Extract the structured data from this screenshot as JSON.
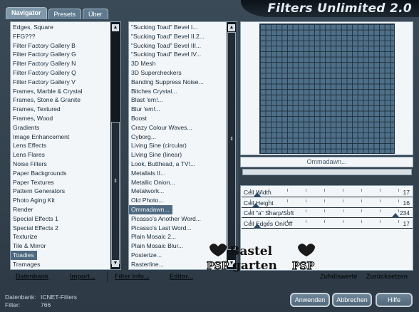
{
  "app_title": "Filters Unlimited 2.0",
  "tabs": [
    "Navigator",
    "Presets",
    "Über"
  ],
  "categories": [
    "Edges, Square",
    "FFG???",
    "Filter Factory Gallery B",
    "Filter Factory Gallery G",
    "Filter Factory Gallery N",
    "Filter Factory Gallery Q",
    "Filter Factory Gallery V",
    "Frames, Marble & Crystal",
    "Frames, Stone & Granite",
    "Frames, Textured",
    "Frames, Wood",
    "Gradients",
    "Image Enhancement",
    "Lens Effects",
    "Lens Flares",
    "Noise Filters",
    "Paper Backgrounds",
    "Paper Textures",
    "Pattern Generators",
    "Photo Aging Kit",
    "Render",
    "Special Effects 1",
    "Special Effects 2",
    "Texturize",
    "Tile & Mirror",
    "Toadies",
    "Tramages"
  ],
  "selected_category": "Toadies",
  "filters": [
    "\"Sucking Toad\"  Bevel I...",
    "\"Sucking Toad\"  Bevel II.2...",
    "\"Sucking Toad\"  Bevel III...",
    "\"Sucking Toad\"  Bevel IV...",
    "3D Mesh",
    "3D Supercheckers",
    "Banding Suppress Noise...",
    "Bitches Crystal...",
    "Blast 'em!...",
    "Blur 'em!...",
    "Boost",
    "Crazy Colour Waves...",
    "Cyborg...",
    "Living Sine (circular)",
    "Living Sine (linear)",
    "Look, Butthead, a TV!...",
    "Metallals II...",
    "Metallic Onion...",
    "Metalwork...",
    "Old Photo...",
    "Ommadawn...",
    "Picasso's Another Word...",
    "Picasso's Last Word...",
    "Plain Mosaic 2...",
    "Plain Mosaic Blur...",
    "Posterize...",
    "Rasterline..."
  ],
  "selected_filter": "Ommadawn...",
  "preview_filter_name": "Ommadawn...",
  "sliders": [
    {
      "label": "Cell Width",
      "value": "17",
      "level": 0.07
    },
    {
      "label": "Cell Height",
      "value": "16",
      "level": 0.06
    },
    {
      "label": "Cell \"a\" Sharp/Soft",
      "value": "234",
      "level": 0.92
    },
    {
      "label": "Cell Edges On/Off",
      "value": "17",
      "level": 0.07
    }
  ],
  "watermark_text": "Bastel PSP garten PSP",
  "actions": {
    "database": "Datenbank",
    "import": "Import...",
    "filter_info": "Filter Info...",
    "editor": "Editor...",
    "random": "Zufallswerte",
    "reset": "Zurücksetzen"
  },
  "info": {
    "db_label": "Datenbank:",
    "db_value": "ICNET-Filters",
    "filter_label": "Filter:",
    "filter_value": "766"
  },
  "buttons": {
    "apply": "Anwenden",
    "cancel": "Abbrechen",
    "help": "Hilfe"
  },
  "colors": {
    "window_bg": "#33414d",
    "preview_tile": "#4f6f88",
    "selection": "#4f6a80"
  }
}
